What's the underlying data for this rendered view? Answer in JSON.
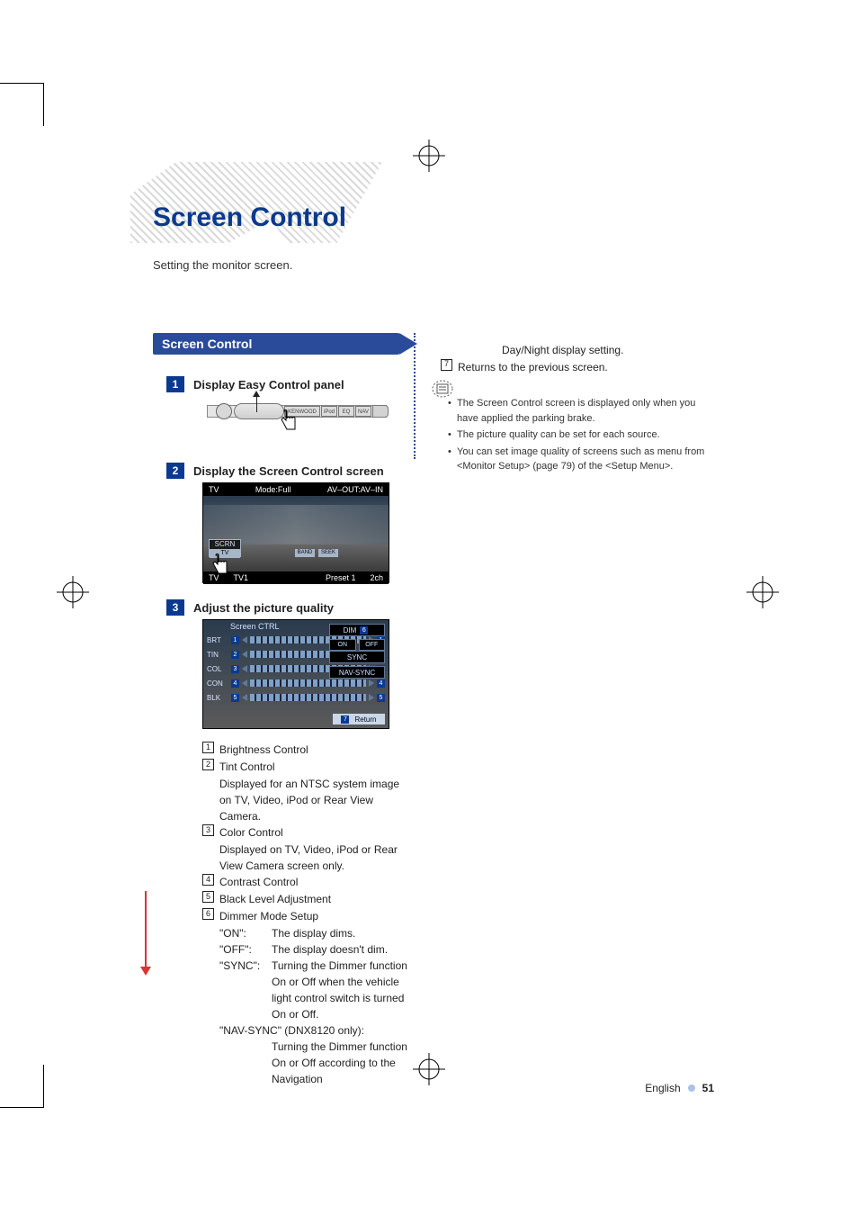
{
  "title": "Screen Control",
  "subtitle": "Setting the monitor screen.",
  "tab": "Screen Control",
  "steps": {
    "s1": {
      "num": "1",
      "label": "Display Easy Control panel"
    },
    "s2": {
      "num": "2",
      "label": "Display the Screen Control screen"
    },
    "s3": {
      "num": "3",
      "label": "Adjust the picture quality"
    }
  },
  "device": {
    "kenwood": "KENWOOD",
    "ipod": "iPod",
    "eq": "EQ",
    "nav": "NAV"
  },
  "shot2": {
    "top_left": "TV",
    "top_mid": "Mode:Full",
    "top_right": "AV–OUT:AV–IN",
    "scrn": "SCRN",
    "scrn_tv": "TV",
    "bot": {
      "a": "TV",
      "b": "TV1",
      "c": "Preset 1",
      "d": "2ch"
    },
    "btn": {
      "band": "BAND",
      "seek": "SEEK"
    }
  },
  "shot3": {
    "header": "Screen CTRL",
    "rows": [
      {
        "lab": "BRT",
        "n": "1"
      },
      {
        "lab": "TIN",
        "n": "2"
      },
      {
        "lab": "COL",
        "n": "3"
      },
      {
        "lab": "CON",
        "n": "4"
      },
      {
        "lab": "BLK",
        "n": "5"
      }
    ],
    "dim": "DIM",
    "dim_n": "6",
    "on": "ON",
    "off": "OFF",
    "sync": "SYNC",
    "navsync": "NAV-SYNC",
    "return": "Return",
    "return_n": "7"
  },
  "legend": {
    "i1": "Brightness Control",
    "i2": "Tint Control",
    "i2b": "Displayed for an NTSC system image on TV, Video, iPod or Rear View Camera.",
    "i3": "Color Control",
    "i3b": "Displayed on TV, Video, iPod or Rear View Camera screen only.",
    "i4": "Contrast Control",
    "i5": "Black Level Adjustment",
    "i6": "Dimmer Mode Setup",
    "d_on_k": "\"ON\":",
    "d_on_v": "The display dims.",
    "d_off_k": "\"OFF\":",
    "d_off_v": "The display doesn't dim.",
    "d_sync_k": "\"SYNC\":",
    "d_sync_v": "Turning the Dimmer function On or Off when the vehicle light control switch is turned On or Off.",
    "d_nav_k": "\"NAV-SYNC\" (DNX8120 only):",
    "d_nav_v": "Turning the Dimmer function On or Off according to the Navigation"
  },
  "right": {
    "cont": "Day/Night display setting.",
    "i7": "Returns to the previous screen."
  },
  "notes": [
    "The Screen Control screen is displayed only when you have applied the parking brake.",
    "The picture quality can be set for each source.",
    "You can set image quality of screens such as menu from <Monitor Setup> (page 79) of the <Setup Menu>."
  ],
  "footer": {
    "lang": "English",
    "page": "51"
  }
}
